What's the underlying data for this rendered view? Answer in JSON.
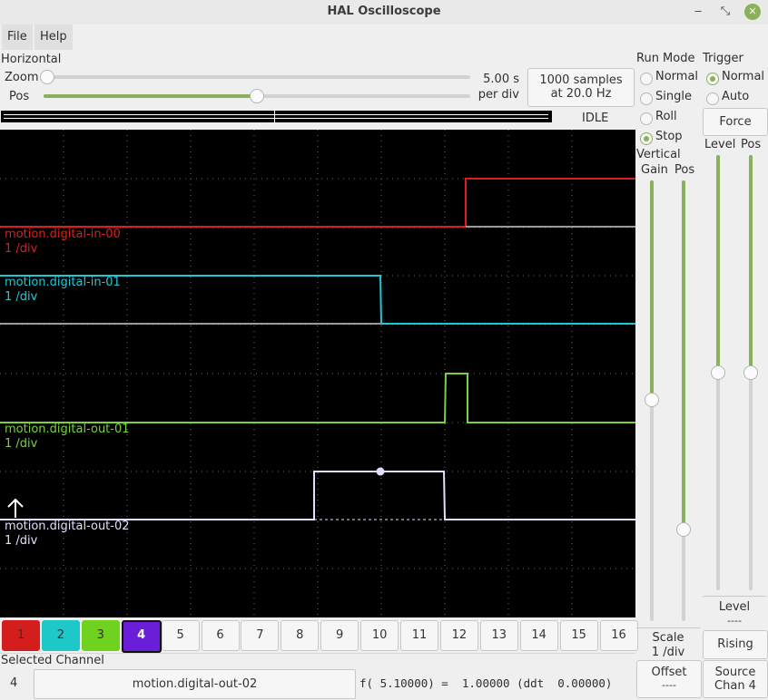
{
  "window": {
    "title": "HAL Oscilloscope",
    "minimize": "‒",
    "maximize": "⤡",
    "close": "✕"
  },
  "menu": {
    "file": "File",
    "help": "Help"
  },
  "horizontal": {
    "label": "Horizontal",
    "zoom_label": "Zoom",
    "pos_label": "Pos",
    "zoom_value": 0.0,
    "pos_value": 0.5,
    "per_div_value": "5.00 s",
    "per_div_unit": "per div",
    "samples_line1": "1000 samples",
    "samples_line2": "at 20.0 Hz",
    "state": "IDLE"
  },
  "run_mode": {
    "label": "Run Mode",
    "options": [
      "Normal",
      "Single",
      "Roll",
      "Stop"
    ],
    "selected": "Stop"
  },
  "trigger": {
    "label": "Trigger",
    "options": [
      "Normal",
      "Auto"
    ],
    "selected": "Normal",
    "force_label": "Force",
    "level_label": "Level",
    "pos_label": "Pos",
    "level_value_label": "Level",
    "level_value": "----",
    "edge_label": "Rising",
    "source_line1": "Source",
    "source_line2": "Chan 4"
  },
  "vertical": {
    "label": "Vertical",
    "gain_label": "Gain",
    "pos_label": "Pos",
    "scale_label": "Scale",
    "scale_value": "1 /div",
    "offset_label": "Offset",
    "offset_value": "----"
  },
  "channels": {
    "buttons": [
      "1",
      "2",
      "3",
      "4",
      "5",
      "6",
      "7",
      "8",
      "9",
      "10",
      "11",
      "12",
      "13",
      "14",
      "15",
      "16"
    ],
    "active_colors": {
      "1": "#d41e1e",
      "2": "#1ec8c8",
      "3": "#6ed21e",
      "4": "#6a1ed8"
    },
    "selected": "4"
  },
  "traces": [
    {
      "name": "motion.digital-in-00",
      "scale": "1 /div",
      "color": "#d81e1e"
    },
    {
      "name": "motion.digital-in-01",
      "scale": "1 /div",
      "color": "#1ec8d2"
    },
    {
      "name": "motion.digital-out-01",
      "scale": "1 /div",
      "color": "#78d23c"
    },
    {
      "name": "motion.digital-out-02",
      "scale": "1 /div",
      "color": "#e6dcff"
    }
  ],
  "selected_channel": {
    "label": "Selected Channel",
    "number": "4",
    "name": "motion.digital-out-02",
    "readout": "f( 5.10000) =  1.00000 (ddt  0.00000)"
  }
}
